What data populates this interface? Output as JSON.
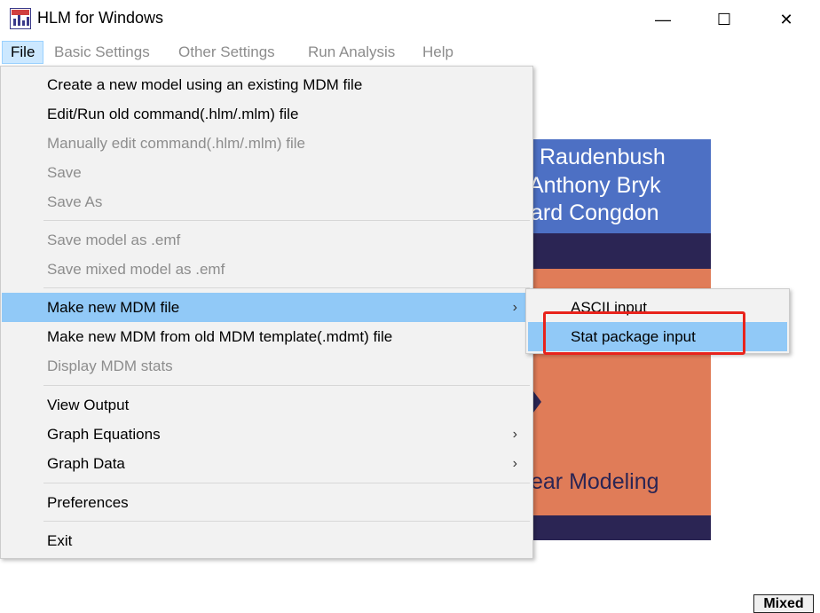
{
  "window": {
    "title": "HLM for Windows",
    "minimize": "—",
    "maximize": "☐",
    "close": "✕"
  },
  "menubar": {
    "file": "File",
    "basic_settings": "Basic Settings",
    "other_settings": "Other Settings",
    "run_analysis": "Run Analysis",
    "help": "Help"
  },
  "file_menu": {
    "create_new_model": "Create a new model using an existing MDM file",
    "edit_run_old": "Edit/Run old command(.hlm/.mlm) file",
    "manually_edit": "Manually edit command(.hlm/.mlm) file",
    "save": "Save",
    "save_as": "Save As",
    "save_model_emf": "Save model as .emf",
    "save_mixed_emf": "Save mixed model as .emf",
    "make_new_mdm": "Make new MDM file",
    "make_mdm_template": "Make new MDM from old MDM template(.mdmt) file",
    "display_mdm_stats": "Display MDM stats",
    "view_output": "View Output",
    "graph_equations": "Graph Equations",
    "graph_data": "Graph Data",
    "preferences": "Preferences",
    "exit": "Exit",
    "submenu_arrow": "›"
  },
  "submenu": {
    "ascii_input": "ASCII input",
    "stat_package_input": "Stat package input"
  },
  "cover": {
    "line1": "Raudenbush",
    "line2": "Anthony Bryk",
    "line3": "ard Congdon",
    "line4": "ear Modeling"
  },
  "status": {
    "mode": "Mixed"
  },
  "colors": {
    "highlight": "#91c9f7",
    "annotation": "#e8231c",
    "cover_blue": "#4d70c4",
    "cover_orange": "#e07c58",
    "cover_dark": "#2b2554"
  }
}
